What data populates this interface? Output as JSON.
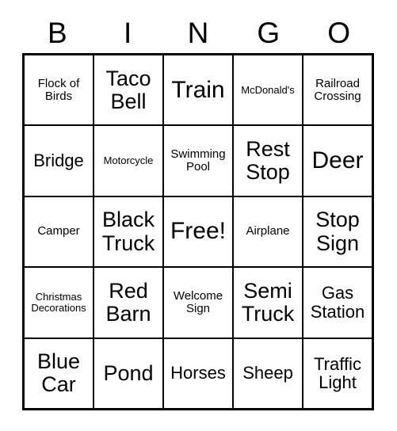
{
  "card": {
    "title": "BINGO",
    "header_letters": [
      "B",
      "I",
      "N",
      "G",
      "O"
    ],
    "grid_columns": 5,
    "grid_rows": 5,
    "colors": {
      "border": "#000000",
      "background": "#ffffff",
      "text": "#000000"
    },
    "free_space": "Free!",
    "cells": [
      [
        {
          "label": "Flock of Birds",
          "size": "sm"
        },
        {
          "label": "Taco Bell",
          "size": "lg"
        },
        {
          "label": "Train",
          "size": "xl"
        },
        {
          "label": "McDonald's",
          "size": "xs"
        },
        {
          "label": "Railroad Crossing",
          "size": "sm"
        }
      ],
      [
        {
          "label": "Bridge",
          "size": "md"
        },
        {
          "label": "Motorcycle",
          "size": "xs"
        },
        {
          "label": "Swimming Pool",
          "size": "sm"
        },
        {
          "label": "Rest Stop",
          "size": "lg"
        },
        {
          "label": "Deer",
          "size": "xl"
        }
      ],
      [
        {
          "label": "Camper",
          "size": "sm"
        },
        {
          "label": "Black Truck",
          "size": "lg"
        },
        {
          "label": "Free!",
          "size": "xl"
        },
        {
          "label": "Airplane",
          "size": "sm"
        },
        {
          "label": "Stop Sign",
          "size": "lg"
        }
      ],
      [
        {
          "label": "Christmas Decorations",
          "size": "xs"
        },
        {
          "label": "Red Barn",
          "size": "lg"
        },
        {
          "label": "Welcome Sign",
          "size": "sm"
        },
        {
          "label": "Semi Truck",
          "size": "lg"
        },
        {
          "label": "Gas Station",
          "size": "md"
        }
      ],
      [
        {
          "label": "Blue Car",
          "size": "lg"
        },
        {
          "label": "Pond",
          "size": "lg"
        },
        {
          "label": "Horses",
          "size": "md"
        },
        {
          "label": "Sheep",
          "size": "md"
        },
        {
          "label": "Traffic Light",
          "size": "md"
        }
      ]
    ]
  }
}
